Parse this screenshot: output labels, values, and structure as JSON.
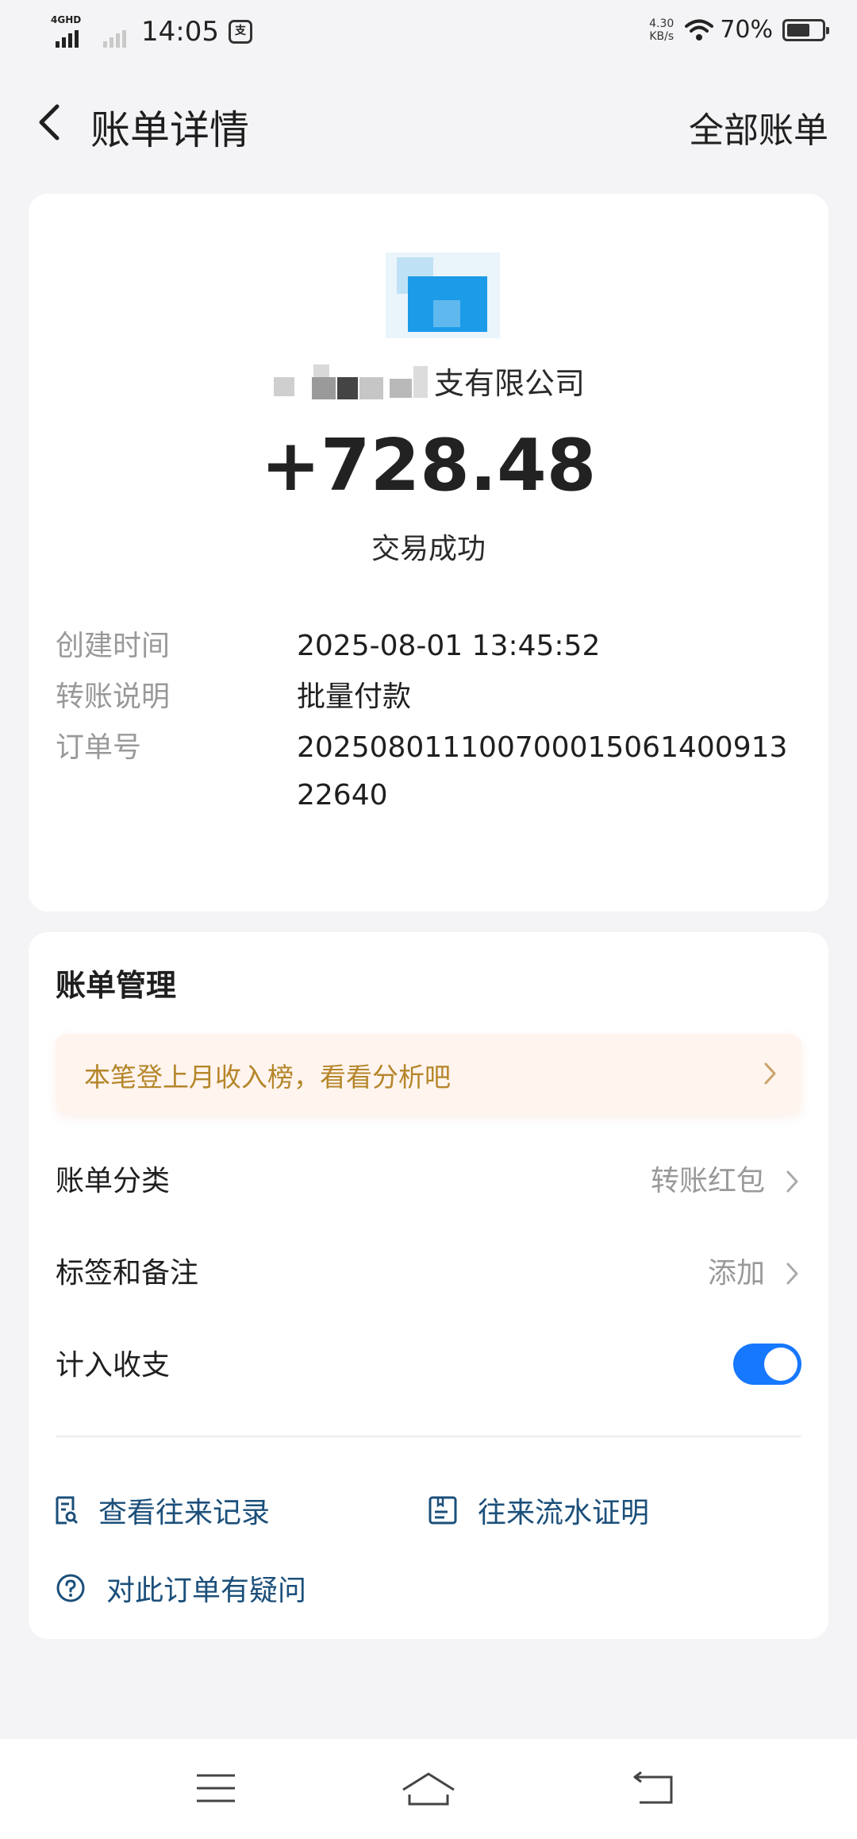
{
  "status_bar": {
    "network_label": "4GHD",
    "time": "14:05",
    "net_speed_value": "4.30",
    "net_speed_unit": "KB/s",
    "battery_percent": "70%"
  },
  "header": {
    "title": "账单详情",
    "right_link": "全部账单"
  },
  "transaction": {
    "merchant_name_visible": "支有限公司",
    "amount": "+728.48",
    "status": "交易成功",
    "details": [
      {
        "label": "创建时间",
        "value": "2025-08-01 13:45:52"
      },
      {
        "label": "转账说明",
        "value": "批量付款"
      },
      {
        "label": "订单号",
        "value": "20250801110070001506140091322640"
      }
    ]
  },
  "management": {
    "title": "账单管理",
    "banner": "本笔登上月收入榜，看看分析吧",
    "rows": [
      {
        "label": "账单分类",
        "value": "转账红包"
      },
      {
        "label": "标签和备注",
        "value": "添加"
      },
      {
        "label": "计入收支",
        "toggle_on": true
      }
    ],
    "links": [
      {
        "label": "查看往来记录",
        "icon": "record-search-icon"
      },
      {
        "label": "往来流水证明",
        "icon": "statement-proof-icon"
      },
      {
        "label": "对此订单有疑问",
        "icon": "question-circle-icon"
      }
    ]
  },
  "colors": {
    "accent": "#1677ff",
    "banner_text": "#b5862a",
    "link_text": "#1b4f7a"
  }
}
